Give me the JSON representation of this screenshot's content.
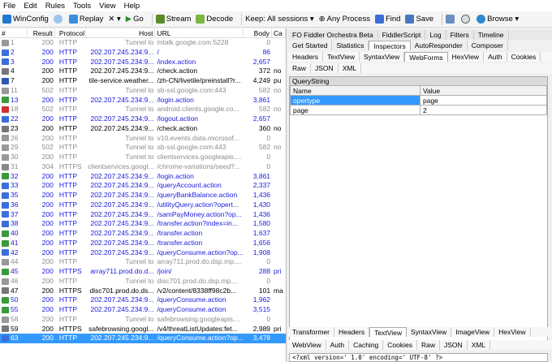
{
  "menu": [
    "File",
    "Edit",
    "Rules",
    "Tools",
    "View",
    "Help"
  ],
  "toolbar": {
    "winconfig": "WinConfig",
    "replay": "Replay",
    "remove": "✕ ▾",
    "go": "Go",
    "stream": "Stream",
    "decode": "Decode",
    "keep": "Keep: All sessions ▾",
    "process": "Any Process",
    "find": "Find",
    "save": "Save",
    "browse": "Browse ▾"
  },
  "columns": [
    "#",
    "Result",
    "Protocol",
    "Host",
    "URL",
    "Body",
    "Ca"
  ],
  "rows": [
    {
      "n": "1",
      "r": "200",
      "p": "HTTP",
      "h": "Tunnel to",
      "u": "mtalk.google.com:5228",
      "b": "0",
      "c": "",
      "s": "tun",
      "ic": "#999"
    },
    {
      "n": "2",
      "r": "200",
      "p": "HTTP",
      "h": "202.207.245.234:9...",
      "u": "/",
      "b": "86",
      "c": "",
      "s": "blue",
      "ic": "#3a6fd8"
    },
    {
      "n": "3",
      "r": "200",
      "p": "HTTP",
      "h": "202.207.245.234:9...",
      "u": "/index.action",
      "b": "2,657",
      "c": "",
      "s": "blue",
      "ic": "#3a6fd8"
    },
    {
      "n": "4",
      "r": "200",
      "p": "HTTP",
      "h": "202.207.245.234:9...",
      "u": "/check.action",
      "b": "372",
      "c": "no",
      "s": "blk",
      "ic": "#777"
    },
    {
      "n": "7",
      "r": "200",
      "p": "HTTP",
      "h": "tile-service.weather...",
      "u": "/zh-CN/livetile/preinstall?r...",
      "b": "4,249",
      "c": "pu",
      "s": "blk",
      "ic": "#2a5ab0"
    },
    {
      "n": "11",
      "r": "502",
      "p": "HTTP",
      "h": "Tunnel to",
      "u": "sb-ssl.google.com:443",
      "b": "582",
      "c": "no",
      "s": "tun",
      "ic": "#999"
    },
    {
      "n": "13",
      "r": "200",
      "p": "HTTP",
      "h": "202.207.245.234:9...",
      "u": "/login.action",
      "b": "3,861",
      "c": "",
      "s": "blue",
      "ic": "#3a9a3a"
    },
    {
      "n": "18",
      "r": "502",
      "p": "HTTP",
      "h": "Tunnel to",
      "u": "android.clients.google.co...",
      "b": "582",
      "c": "no",
      "s": "tun",
      "ic": "#d03030"
    },
    {
      "n": "22",
      "r": "200",
      "p": "HTTP",
      "h": "202.207.245.234:9...",
      "u": "/logout.action",
      "b": "2,657",
      "c": "",
      "s": "blue",
      "ic": "#3a6fd8"
    },
    {
      "n": "23",
      "r": "200",
      "p": "HTTP",
      "h": "202.207.245.234:9...",
      "u": "/check.action",
      "b": "360",
      "c": "no",
      "s": "blk",
      "ic": "#777"
    },
    {
      "n": "26",
      "r": "200",
      "p": "HTTP",
      "h": "Tunnel to",
      "u": "v10.events.data.microsof...",
      "b": "0",
      "c": "",
      "s": "tun",
      "ic": "#999"
    },
    {
      "n": "29",
      "r": "502",
      "p": "HTTP",
      "h": "Tunnel to",
      "u": "sb-ssl.google.com:443",
      "b": "582",
      "c": "no",
      "s": "tun",
      "ic": "#999"
    },
    {
      "n": "30",
      "r": "200",
      "p": "HTTP",
      "h": "Tunnel to",
      "u": "clientservices.googleapis....",
      "b": "0",
      "c": "",
      "s": "tun",
      "ic": "#999"
    },
    {
      "n": "31",
      "r": "304",
      "p": "HTTPS",
      "h": "clientservices.googl...",
      "u": "/chrome-variations/seed?...",
      "b": "0",
      "c": "",
      "s": "tun",
      "ic": "#888"
    },
    {
      "n": "32",
      "r": "200",
      "p": "HTTP",
      "h": "202.207.245.234:9...",
      "u": "/login.action",
      "b": "3,861",
      "c": "",
      "s": "blue",
      "ic": "#3a9a3a"
    },
    {
      "n": "33",
      "r": "200",
      "p": "HTTP",
      "h": "202.207.245.234:9...",
      "u": "/queryAccount.action",
      "b": "2,337",
      "c": "",
      "s": "blue",
      "ic": "#3a6fd8"
    },
    {
      "n": "35",
      "r": "200",
      "p": "HTTP",
      "h": "202.207.245.234:9...",
      "u": "/queryBankBalance.action",
      "b": "1,436",
      "c": "",
      "s": "blue",
      "ic": "#3a6fd8"
    },
    {
      "n": "36",
      "r": "200",
      "p": "HTTP",
      "h": "202.207.245.234:9...",
      "u": "/utilityQuery.action?opert...",
      "b": "1,430",
      "c": "",
      "s": "blue",
      "ic": "#3a6fd8"
    },
    {
      "n": "37",
      "r": "200",
      "p": "HTTP",
      "h": "202.207.245.234:9...",
      "u": "/samPayMoney.action?op...",
      "b": "1,436",
      "c": "",
      "s": "blue",
      "ic": "#3a6fd8"
    },
    {
      "n": "38",
      "r": "200",
      "p": "HTTP",
      "h": "202.207.245.234:9...",
      "u": "/transfer.action?index=in...",
      "b": "1,580",
      "c": "",
      "s": "blue",
      "ic": "#3a6fd8"
    },
    {
      "n": "40",
      "r": "200",
      "p": "HTTP",
      "h": "202.207.245.234:9...",
      "u": "/transfer.action",
      "b": "1,637",
      "c": "",
      "s": "blue",
      "ic": "#3a9a3a"
    },
    {
      "n": "41",
      "r": "200",
      "p": "HTTP",
      "h": "202.207.245.234:9...",
      "u": "/transfer.action",
      "b": "1,656",
      "c": "",
      "s": "blue",
      "ic": "#3a9a3a"
    },
    {
      "n": "42",
      "r": "200",
      "p": "HTTP",
      "h": "202.207.245.234:9...",
      "u": "/queryConsume.action?op...",
      "b": "1,908",
      "c": "",
      "s": "blue",
      "ic": "#3a6fd8"
    },
    {
      "n": "44",
      "r": "200",
      "p": "HTTP",
      "h": "Tunnel to",
      "u": "array711.prod.do.dsp.mp....",
      "b": "0",
      "c": "",
      "s": "tun",
      "ic": "#999"
    },
    {
      "n": "45",
      "r": "200",
      "p": "HTTPS",
      "h": "array711.prod.do.d...",
      "u": "/join/",
      "b": "288",
      "c": "pri",
      "s": "blue",
      "ic": "#3a9a3a"
    },
    {
      "n": "46",
      "r": "200",
      "p": "HTTP",
      "h": "Tunnel to",
      "u": "disc701.prod.do.dsp.mp....",
      "b": "0",
      "c": "",
      "s": "tun",
      "ic": "#999"
    },
    {
      "n": "47",
      "r": "200",
      "p": "HTTPS",
      "h": "disc701.prod.do.ds...",
      "u": "/v2/content/8338ff98c2b...",
      "b": "101",
      "c": "ma",
      "s": "blk",
      "ic": "#777"
    },
    {
      "n": "50",
      "r": "200",
      "p": "HTTP",
      "h": "202.207.245.234:9...",
      "u": "/queryConsume.action",
      "b": "1,962",
      "c": "",
      "s": "blue",
      "ic": "#3a9a3a"
    },
    {
      "n": "55",
      "r": "200",
      "p": "HTTP",
      "h": "202.207.245.234:9...",
      "u": "/queryConsume.action",
      "b": "3,515",
      "c": "",
      "s": "blue",
      "ic": "#3a9a3a"
    },
    {
      "n": "58",
      "r": "200",
      "p": "HTTP",
      "h": "Tunnel to",
      "u": "safebrowsing.googleapis....",
      "b": "0",
      "c": "",
      "s": "tun",
      "ic": "#999"
    },
    {
      "n": "59",
      "r": "200",
      "p": "HTTPS",
      "h": "safebrowsing.googl...",
      "u": "/v4/threatListUpdates:fet...",
      "b": "2,989",
      "c": "pri",
      "s": "blk",
      "ic": "#777"
    },
    {
      "n": "63",
      "r": "200",
      "p": "HTTP",
      "h": "202.207.245.234:9...",
      "u": "/queryConsume.action?op...",
      "b": "3,478",
      "c": "",
      "s": "sel",
      "ic": "#3a6fd8"
    }
  ],
  "right": {
    "tabs1": [
      "FO Fiddler Orchestra Beta",
      "FiddlerScript",
      "Log",
      "Filters",
      "Timeline"
    ],
    "tabs2": [
      "Get Started",
      "Statistics",
      "Inspectors",
      "AutoResponder",
      "Composer"
    ],
    "tabs3": [
      "Headers",
      "TextView",
      "SyntaxView",
      "WebForms",
      "HexView",
      "Auth",
      "Cookies"
    ],
    "tabs4": [
      "Raw",
      "JSON",
      "XML"
    ],
    "qs_title": "QueryString",
    "qs_head": [
      "Name",
      "Value"
    ],
    "qs_rows": [
      [
        "opertype",
        "page"
      ],
      [
        "page",
        "2"
      ]
    ],
    "tabs5": [
      "Transformer",
      "Headers",
      "TextView",
      "SyntaxView",
      "ImageView",
      "HexView"
    ],
    "tabs6": [
      "WebView",
      "Auth",
      "Caching",
      "Cookies",
      "Raw",
      "JSON",
      "XML"
    ],
    "xml": "<?xml version=' 1.0' encoding=' UTF-8' ?>"
  }
}
